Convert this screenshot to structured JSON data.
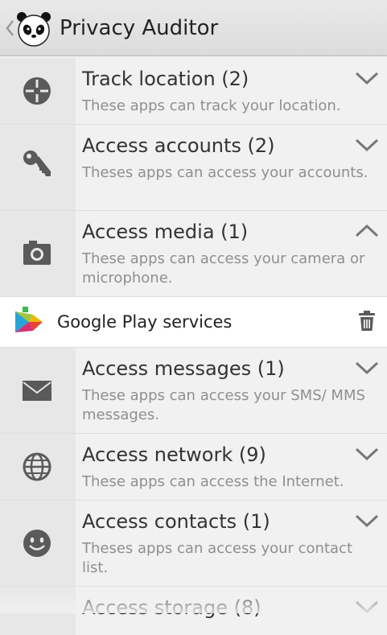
{
  "header": {
    "title": "Privacy Auditor",
    "back_icon": "chevron-left-icon",
    "logo": "panda-logo"
  },
  "categories": [
    {
      "title": "Track location (2)",
      "description": "These apps can track your location.",
      "icon": "crosshair-icon",
      "expanded": false
    },
    {
      "title": "Access accounts (2)",
      "description": "Theses apps can access your accounts.",
      "icon": "key-icon",
      "expanded": false
    },
    {
      "title": "Access media (1)",
      "description": "These apps can access your camera or microphone.",
      "icon": "camera-icon",
      "expanded": true
    },
    {
      "title": "Access messages (1)",
      "description": "These apps can access your SMS/ MMS messages.",
      "icon": "envelope-icon",
      "expanded": false
    },
    {
      "title": "Access network (9)",
      "description": "These apps can access the Internet.",
      "icon": "globe-icon",
      "expanded": false
    },
    {
      "title": "Access contacts (1)",
      "description": "Theses apps can access your contact list.",
      "icon": "smiley-icon",
      "expanded": false
    },
    {
      "title": "Access storage (8)",
      "description": "",
      "icon": "storage-icon",
      "expanded": false
    }
  ],
  "expanded_apps": [
    {
      "name": "Google Play services",
      "icon": "google-play-services-icon",
      "action_icon": "trash-icon"
    }
  ],
  "colors": {
    "icon_gray": "#5a5a5a",
    "title_text": "#333333",
    "desc_text": "#8f8f8f",
    "icon_column_bg": "#e7e7e7",
    "row_bg": "#f1f1f1"
  }
}
